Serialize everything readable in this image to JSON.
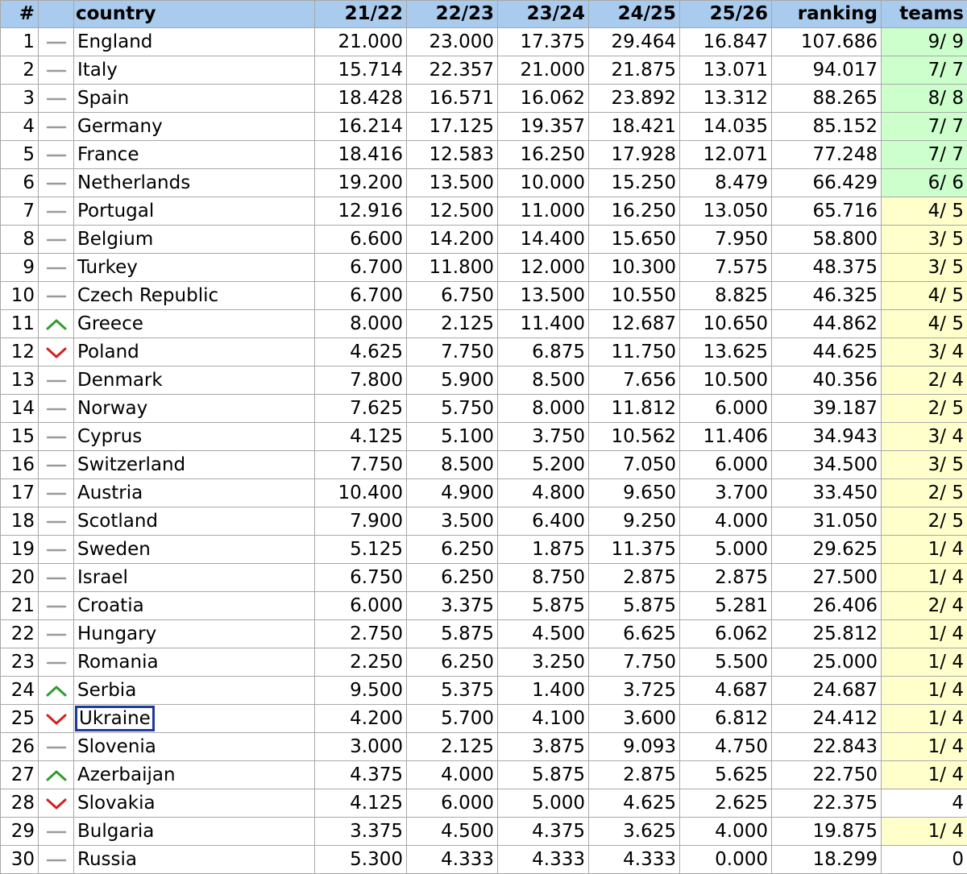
{
  "header": {
    "num": "#",
    "movement": "",
    "country": "country",
    "s1": "21/22",
    "s2": "22/23",
    "s3": "23/24",
    "s4": "24/25",
    "s5": "25/26",
    "ranking": "ranking",
    "teams": "teams"
  },
  "colors": {
    "header_bg": "#a9cbee",
    "teams_green": "#ccffcc",
    "teams_yellow": "#ffffcc",
    "arrow_up": "#2e9e2e",
    "arrow_down": "#d42020",
    "no_change": "#9a9a9a",
    "selection_border": "#1a3a9c"
  },
  "selected_row": 25,
  "rows": [
    {
      "num": "1",
      "move": "same",
      "country": "England",
      "s1": "21.000",
      "s2": "23.000",
      "s3": "17.375",
      "s4": "29.464",
      "s5": "16.847",
      "ranking": "107.686",
      "teams": "9/ 9",
      "teams_color": "green"
    },
    {
      "num": "2",
      "move": "same",
      "country": "Italy",
      "s1": "15.714",
      "s2": "22.357",
      "s3": "21.000",
      "s4": "21.875",
      "s5": "13.071",
      "ranking": "94.017",
      "teams": "7/ 7",
      "teams_color": "green"
    },
    {
      "num": "3",
      "move": "same",
      "country": "Spain",
      "s1": "18.428",
      "s2": "16.571",
      "s3": "16.062",
      "s4": "23.892",
      "s5": "13.312",
      "ranking": "88.265",
      "teams": "8/ 8",
      "teams_color": "green"
    },
    {
      "num": "4",
      "move": "same",
      "country": "Germany",
      "s1": "16.214",
      "s2": "17.125",
      "s3": "19.357",
      "s4": "18.421",
      "s5": "14.035",
      "ranking": "85.152",
      "teams": "7/ 7",
      "teams_color": "green"
    },
    {
      "num": "5",
      "move": "same",
      "country": "France",
      "s1": "18.416",
      "s2": "12.583",
      "s3": "16.250",
      "s4": "17.928",
      "s5": "12.071",
      "ranking": "77.248",
      "teams": "7/ 7",
      "teams_color": "green"
    },
    {
      "num": "6",
      "move": "same",
      "country": "Netherlands",
      "s1": "19.200",
      "s2": "13.500",
      "s3": "10.000",
      "s4": "15.250",
      "s5": "8.479",
      "ranking": "66.429",
      "teams": "6/ 6",
      "teams_color": "green"
    },
    {
      "num": "7",
      "move": "same",
      "country": "Portugal",
      "s1": "12.916",
      "s2": "12.500",
      "s3": "11.000",
      "s4": "16.250",
      "s5": "13.050",
      "ranking": "65.716",
      "teams": "4/ 5",
      "teams_color": "yellow"
    },
    {
      "num": "8",
      "move": "same",
      "country": "Belgium",
      "s1": "6.600",
      "s2": "14.200",
      "s3": "14.400",
      "s4": "15.650",
      "s5": "7.950",
      "ranking": "58.800",
      "teams": "3/ 5",
      "teams_color": "yellow"
    },
    {
      "num": "9",
      "move": "same",
      "country": "Turkey",
      "s1": "6.700",
      "s2": "11.800",
      "s3": "12.000",
      "s4": "10.300",
      "s5": "7.575",
      "ranking": "48.375",
      "teams": "3/ 5",
      "teams_color": "yellow"
    },
    {
      "num": "10",
      "move": "same",
      "country": "Czech Republic",
      "s1": "6.700",
      "s2": "6.750",
      "s3": "13.500",
      "s4": "10.550",
      "s5": "8.825",
      "ranking": "46.325",
      "teams": "4/ 5",
      "teams_color": "yellow"
    },
    {
      "num": "11",
      "move": "up",
      "country": "Greece",
      "s1": "8.000",
      "s2": "2.125",
      "s3": "11.400",
      "s4": "12.687",
      "s5": "10.650",
      "ranking": "44.862",
      "teams": "4/ 5",
      "teams_color": "yellow"
    },
    {
      "num": "12",
      "move": "down",
      "country": "Poland",
      "s1": "4.625",
      "s2": "7.750",
      "s3": "6.875",
      "s4": "11.750",
      "s5": "13.625",
      "ranking": "44.625",
      "teams": "3/ 4",
      "teams_color": "yellow"
    },
    {
      "num": "13",
      "move": "same",
      "country": "Denmark",
      "s1": "7.800",
      "s2": "5.900",
      "s3": "8.500",
      "s4": "7.656",
      "s5": "10.500",
      "ranking": "40.356",
      "teams": "2/ 4",
      "teams_color": "yellow"
    },
    {
      "num": "14",
      "move": "same",
      "country": "Norway",
      "s1": "7.625",
      "s2": "5.750",
      "s3": "8.000",
      "s4": "11.812",
      "s5": "6.000",
      "ranking": "39.187",
      "teams": "2/ 5",
      "teams_color": "yellow"
    },
    {
      "num": "15",
      "move": "same",
      "country": "Cyprus",
      "s1": "4.125",
      "s2": "5.100",
      "s3": "3.750",
      "s4": "10.562",
      "s5": "11.406",
      "ranking": "34.943",
      "teams": "3/ 4",
      "teams_color": "yellow"
    },
    {
      "num": "16",
      "move": "same",
      "country": "Switzerland",
      "s1": "7.750",
      "s2": "8.500",
      "s3": "5.200",
      "s4": "7.050",
      "s5": "6.000",
      "ranking": "34.500",
      "teams": "3/ 5",
      "teams_color": "yellow"
    },
    {
      "num": "17",
      "move": "same",
      "country": "Austria",
      "s1": "10.400",
      "s2": "4.900",
      "s3": "4.800",
      "s4": "9.650",
      "s5": "3.700",
      "ranking": "33.450",
      "teams": "2/ 5",
      "teams_color": "yellow"
    },
    {
      "num": "18",
      "move": "same",
      "country": "Scotland",
      "s1": "7.900",
      "s2": "3.500",
      "s3": "6.400",
      "s4": "9.250",
      "s5": "4.000",
      "ranking": "31.050",
      "teams": "2/ 5",
      "teams_color": "yellow"
    },
    {
      "num": "19",
      "move": "same",
      "country": "Sweden",
      "s1": "5.125",
      "s2": "6.250",
      "s3": "1.875",
      "s4": "11.375",
      "s5": "5.000",
      "ranking": "29.625",
      "teams": "1/ 4",
      "teams_color": "yellow"
    },
    {
      "num": "20",
      "move": "same",
      "country": "Israel",
      "s1": "6.750",
      "s2": "6.250",
      "s3": "8.750",
      "s4": "2.875",
      "s5": "2.875",
      "ranking": "27.500",
      "teams": "1/ 4",
      "teams_color": "yellow"
    },
    {
      "num": "21",
      "move": "same",
      "country": "Croatia",
      "s1": "6.000",
      "s2": "3.375",
      "s3": "5.875",
      "s4": "5.875",
      "s5": "5.281",
      "ranking": "26.406",
      "teams": "2/ 4",
      "teams_color": "yellow"
    },
    {
      "num": "22",
      "move": "same",
      "country": "Hungary",
      "s1": "2.750",
      "s2": "5.875",
      "s3": "4.500",
      "s4": "6.625",
      "s5": "6.062",
      "ranking": "25.812",
      "teams": "1/ 4",
      "teams_color": "yellow"
    },
    {
      "num": "23",
      "move": "same",
      "country": "Romania",
      "s1": "2.250",
      "s2": "6.250",
      "s3": "3.250",
      "s4": "7.750",
      "s5": "5.500",
      "ranking": "25.000",
      "teams": "1/ 4",
      "teams_color": "yellow"
    },
    {
      "num": "24",
      "move": "up",
      "country": "Serbia",
      "s1": "9.500",
      "s2": "5.375",
      "s3": "1.400",
      "s4": "3.725",
      "s5": "4.687",
      "ranking": "24.687",
      "teams": "1/ 4",
      "teams_color": "yellow"
    },
    {
      "num": "25",
      "move": "down",
      "country": "Ukraine",
      "s1": "4.200",
      "s2": "5.700",
      "s3": "4.100",
      "s4": "3.600",
      "s5": "6.812",
      "ranking": "24.412",
      "teams": "1/ 4",
      "teams_color": "yellow"
    },
    {
      "num": "26",
      "move": "same",
      "country": "Slovenia",
      "s1": "3.000",
      "s2": "2.125",
      "s3": "3.875",
      "s4": "9.093",
      "s5": "4.750",
      "ranking": "22.843",
      "teams": "1/ 4",
      "teams_color": "yellow"
    },
    {
      "num": "27",
      "move": "up",
      "country": "Azerbaijan",
      "s1": "4.375",
      "s2": "4.000",
      "s3": "5.875",
      "s4": "2.875",
      "s5": "5.625",
      "ranking": "22.750",
      "teams": "1/ 4",
      "teams_color": "yellow"
    },
    {
      "num": "28",
      "move": "down",
      "country": "Slovakia",
      "s1": "4.125",
      "s2": "6.000",
      "s3": "5.000",
      "s4": "4.625",
      "s5": "2.625",
      "ranking": "22.375",
      "teams": "4",
      "teams_color": "none"
    },
    {
      "num": "29",
      "move": "same",
      "country": "Bulgaria",
      "s1": "3.375",
      "s2": "4.500",
      "s3": "4.375",
      "s4": "3.625",
      "s5": "4.000",
      "ranking": "19.875",
      "teams": "1/ 4",
      "teams_color": "yellow"
    },
    {
      "num": "30",
      "move": "same",
      "country": "Russia",
      "s1": "5.300",
      "s2": "4.333",
      "s3": "4.333",
      "s4": "4.333",
      "s5": "0.000",
      "ranking": "18.299",
      "teams": "0",
      "teams_color": "none"
    }
  ]
}
